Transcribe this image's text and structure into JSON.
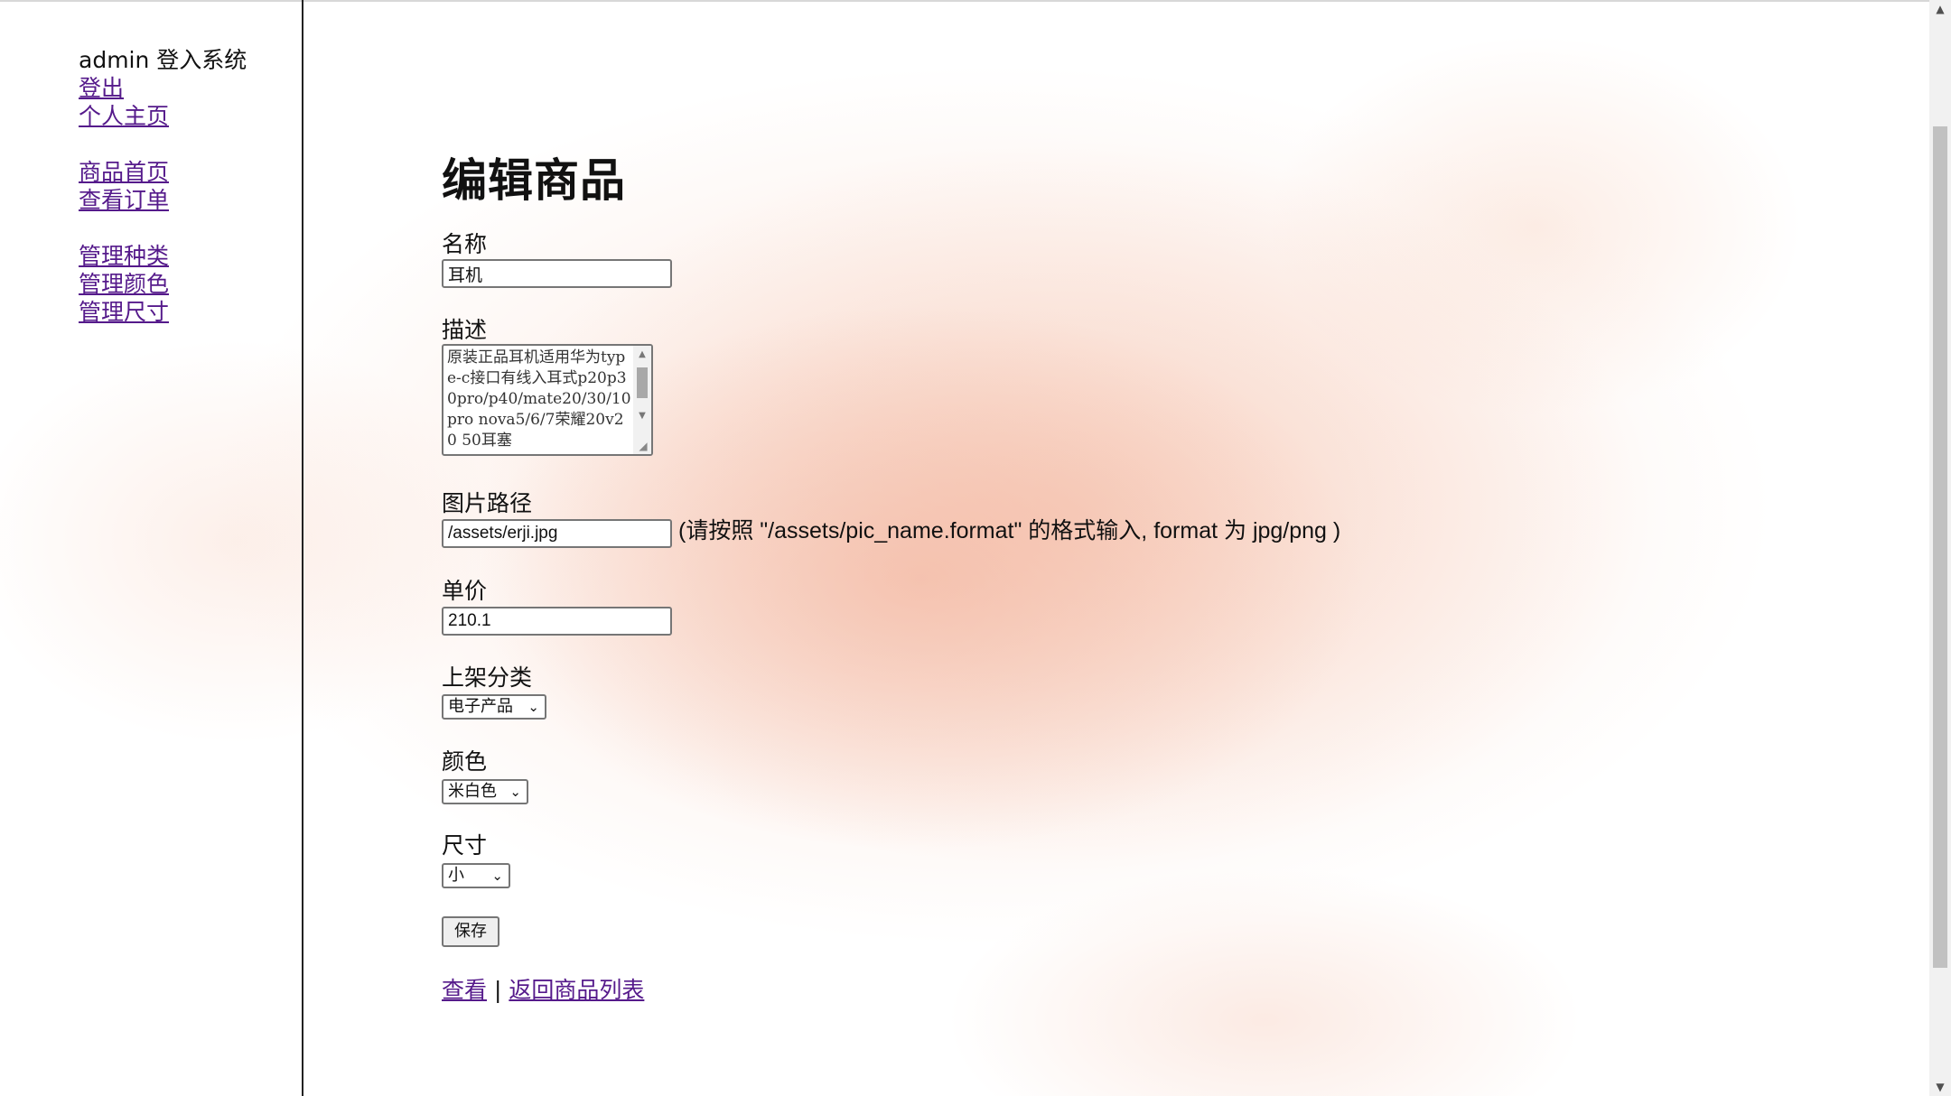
{
  "sidebar": {
    "user_status": "admin 登入系统",
    "links": {
      "logout": "登出",
      "profile": "个人主页",
      "products_home": "商品首页",
      "orders": "查看订单",
      "manage_categories": "管理种类",
      "manage_colors": "管理颜色",
      "manage_sizes": "管理尺寸"
    }
  },
  "page_title": "编辑商品",
  "form": {
    "name": {
      "label": "名称",
      "value": "耳机"
    },
    "description": {
      "label": "描述",
      "value": "原装正品耳机适用华为type-c接口有线入耳式p20p30pro/p40/mate20/30/10pro nova5/6/7荣耀20v20 50耳塞"
    },
    "image_path": {
      "label": "图片路径",
      "value": "/assets/erji.jpg",
      "hint": "(请按照 \"/assets/pic_name.format\" 的格式输入, format 为 jpg/png )"
    },
    "price": {
      "label": "单价",
      "value": "210.1"
    },
    "category": {
      "label": "上架分类",
      "selected": "电子产品"
    },
    "color": {
      "label": "颜色",
      "selected": "米白色"
    },
    "size": {
      "label": "尺寸",
      "selected": "小"
    },
    "save_label": "保存"
  },
  "footer_links": {
    "view": "查看",
    "separator": "|",
    "back_to_list": "返回商品列表"
  },
  "colors": {
    "link": "#551a8b",
    "wash": "#f1ae96"
  }
}
